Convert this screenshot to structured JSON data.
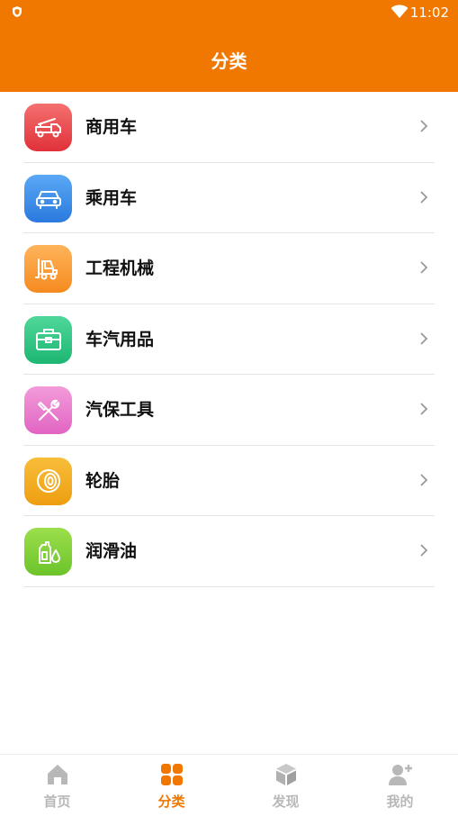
{
  "status_bar": {
    "time": "11:02"
  },
  "header": {
    "title": "分类"
  },
  "categories": [
    {
      "label": "商用车",
      "icon": "truck-icon",
      "color_top": "#F4706F",
      "color_bottom": "#E0313A"
    },
    {
      "label": "乘用车",
      "icon": "car-icon",
      "color_top": "#5AA8F5",
      "color_bottom": "#2A7ADF"
    },
    {
      "label": "工程机械",
      "icon": "forklift-icon",
      "color_top": "#FFB45A",
      "color_bottom": "#F58A1F"
    },
    {
      "label": "车汽用品",
      "icon": "toolbox-icon",
      "color_top": "#4FD79A",
      "color_bottom": "#1DB672"
    },
    {
      "label": "汽保工具",
      "icon": "wrench-screwdriver-icon",
      "color_top": "#F39BDA",
      "color_bottom": "#E164C2"
    },
    {
      "label": "轮胎",
      "icon": "tire-icon",
      "color_top": "#F8BE3A",
      "color_bottom": "#EE9E10"
    },
    {
      "label": "润滑油",
      "icon": "oil-bottle-icon",
      "color_top": "#9CDF4C",
      "color_bottom": "#6CC42A"
    }
  ],
  "tabbar": {
    "tabs": [
      {
        "label": "首页",
        "icon": "home-icon",
        "active": false
      },
      {
        "label": "分类",
        "icon": "grid-icon",
        "active": true
      },
      {
        "label": "发现",
        "icon": "cube-icon",
        "active": false
      },
      {
        "label": "我的",
        "icon": "user-add-icon",
        "active": false
      }
    ],
    "active_color": "#F07800",
    "inactive_color": "#B8B8B8"
  },
  "theme": {
    "accent": "#F07800"
  }
}
